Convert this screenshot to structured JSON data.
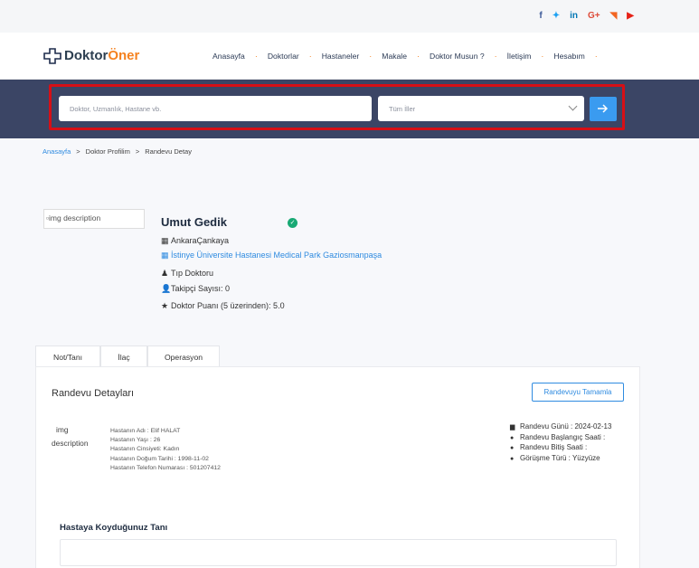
{
  "social": [
    {
      "icon": "facebook-icon",
      "glyph": "f",
      "color": "#3b5998"
    },
    {
      "icon": "twitter-icon",
      "glyph": "🐦",
      "color": "#1da1f2"
    },
    {
      "icon": "linkedin-icon",
      "glyph": "in",
      "color": "#0077b5"
    },
    {
      "icon": "google-plus-icon",
      "glyph": "G+",
      "color": "#dd4b39"
    },
    {
      "icon": "rss-icon",
      "glyph": "◥",
      "color": "#f26522"
    },
    {
      "icon": "youtube-icon",
      "glyph": "▶",
      "color": "#e62117"
    }
  ],
  "logo": {
    "part1": "Doktor",
    "part2": "Öner"
  },
  "nav": [
    "Anasayfa",
    "Doktorlar",
    "Hastaneler",
    "Makale",
    "Doktor Musun ?",
    "İletişim",
    "Hesabım"
  ],
  "search": {
    "placeholder": "Doktor, Uzmanlık, Hastane vb.",
    "city_value": "Tüm İller",
    "button": "→"
  },
  "breadcrumb": {
    "home": "Anasayfa",
    "sep": ">",
    "mid": "Doktor Profilim",
    "current": "Randevu Detay"
  },
  "doctor": {
    "img_alt": "img description",
    "name": "Umut Gedik",
    "location": "AnkaraÇankaya",
    "hospital": "İstinye Üniversite Hastanesi Medical Park Gaziosmanpaşa",
    "specialty": "Tıp Doktoru",
    "followers": "Takipçi Sayısı: 0",
    "rating": "Doktor Puanı (5 üzerinden): 5.0"
  },
  "tabs": [
    "Not/Tanı",
    "İlaç",
    "Operasyon"
  ],
  "panel": {
    "title": "Randevu Detayları",
    "complete_button": "Randevuyu Tamamla",
    "patient_img_alt_1": "img",
    "patient_img_alt_2": "description",
    "patient": [
      "Hastanın Adı : Elif HALAT",
      "Hastanın Yaşı : 26",
      "Hastanın Cinsiyeti: Kadın",
      "Hastanın Doğum Tarihi : 1998-11-02",
      "Hastanın Telefon Numarası : 501207412"
    ],
    "appointment": [
      "Randevu Günü : 2024-02-13",
      "Randevu Başlangıç Saati :",
      "Randevu Bitiş Saati :",
      "Görüşme Türü : Yüzyüze"
    ],
    "diagnosis_label": "Hastaya Koyduğunuz Tanı"
  }
}
